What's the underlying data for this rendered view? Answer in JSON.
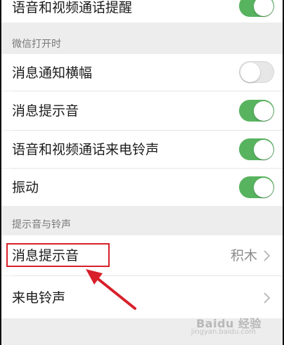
{
  "rows": [
    {
      "label": "语音和视频通话提醒",
      "toggle": "on"
    },
    {
      "label": "消息通知横幅",
      "toggle": "off"
    },
    {
      "label": "消息提示音",
      "toggle": "on"
    },
    {
      "label": "语音和视频通话来电铃声",
      "toggle": "on"
    },
    {
      "label": "振动",
      "toggle": "on"
    }
  ],
  "sections": {
    "wechat_open": "微信打开时",
    "sound_ringtone": "提示音与铃声"
  },
  "sound_rows": [
    {
      "label": "消息提示音",
      "value": "积木"
    },
    {
      "label": "来电铃声",
      "value": ""
    }
  ],
  "watermark": {
    "main": "Baidu 经验",
    "sub": "jingyan.baidu.com"
  },
  "colors": {
    "toggle_on": "#58b35f",
    "toggle_off": "#e7e7e7",
    "annotation_red": "#d7202a"
  }
}
